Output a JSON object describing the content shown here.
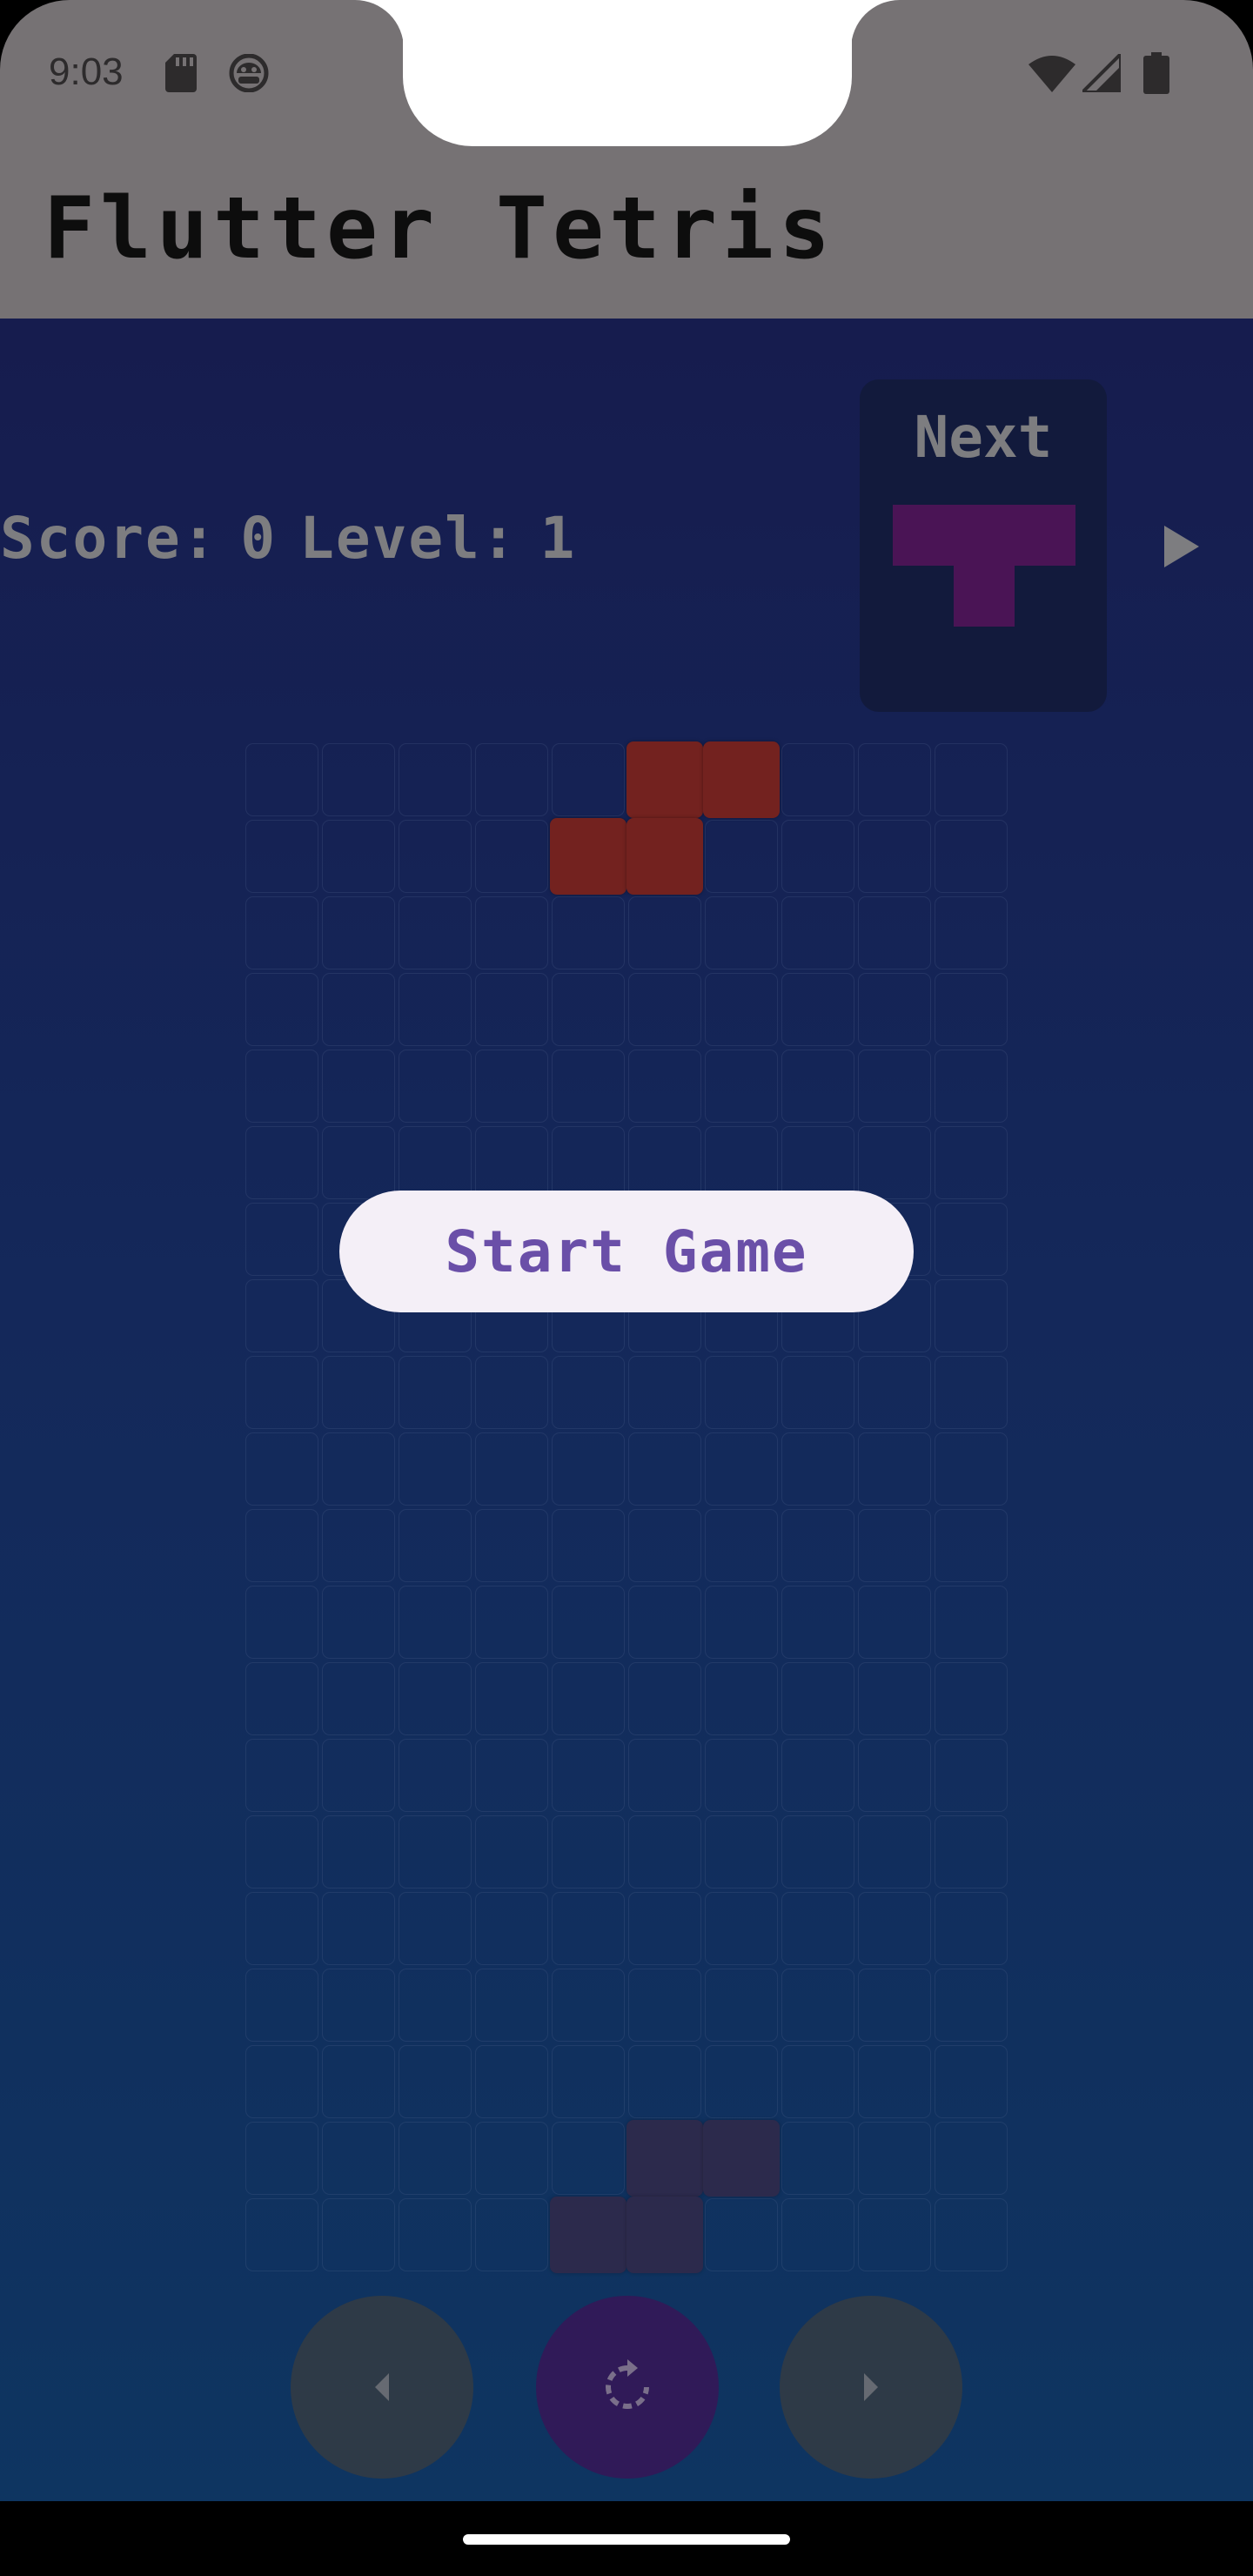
{
  "status_bar": {
    "time": "9:03",
    "left_icons": [
      "sd-card-icon",
      "android-debug-icon"
    ],
    "right_icons": [
      "wifi-icon",
      "signal-icon",
      "battery-icon"
    ]
  },
  "app_bar": {
    "title": "Flutter Tetris"
  },
  "hud": {
    "score_label": "Score:",
    "score_value": "0",
    "level_label": "Level:",
    "level_value": "1",
    "next_label": "Next",
    "next_piece": "T",
    "play_icon": "play-icon"
  },
  "board": {
    "columns": 10,
    "rows": 20,
    "active_piece": {
      "type": "S",
      "color": "#73221f",
      "cells": [
        [
          5,
          0
        ],
        [
          6,
          0
        ],
        [
          4,
          1
        ],
        [
          5,
          1
        ]
      ]
    },
    "ghost_piece": {
      "type": "S",
      "color": "#2c2a4c",
      "cells": [
        [
          5,
          18
        ],
        [
          6,
          18
        ],
        [
          4,
          19
        ],
        [
          5,
          19
        ]
      ]
    }
  },
  "start_button": {
    "label": "Start Game"
  },
  "controls": [
    {
      "name": "move-left-button",
      "icon": "chevron-left-icon"
    },
    {
      "name": "rotate-button",
      "icon": "rotate-icon"
    },
    {
      "name": "move-right-button",
      "icon": "chevron-right-icon"
    }
  ],
  "colors": {
    "app_bar": "#767274",
    "background_top": "#161c4e",
    "background_bottom": "#0e3561",
    "next_piece": "#4a1455",
    "start_button_bg": "#f4eff7",
    "start_button_text": "#6a4fa8"
  }
}
